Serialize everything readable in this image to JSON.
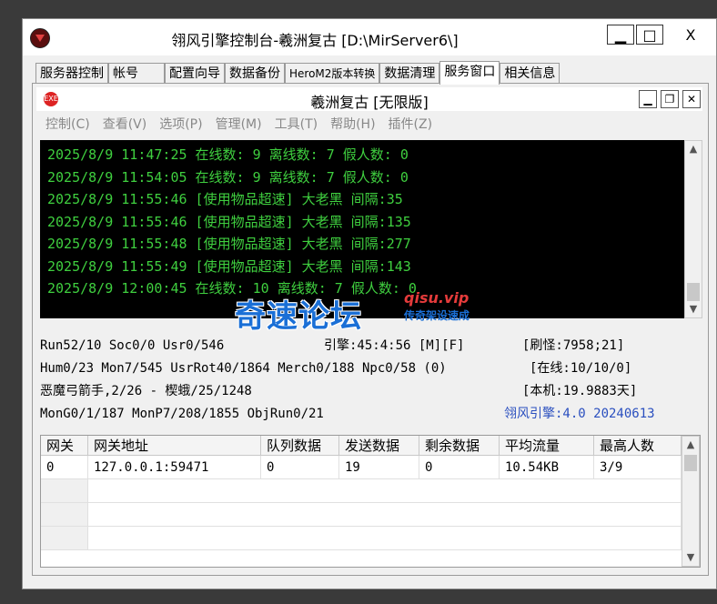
{
  "window": {
    "title": "翎风引擎控制台-羲洲复古 [D:\\MirServer6\\]",
    "minimize": "▁",
    "maximize": "□",
    "close": "X"
  },
  "tabs": [
    "服务器控制",
    "帐号",
    "配置向导",
    "数据备份",
    "HeroM2版本转换",
    "数据清理",
    "服务窗口",
    "相关信息"
  ],
  "active_tab": "服务窗口",
  "inner": {
    "title": "羲洲复古 [无限版]",
    "icon_text": "EXE",
    "minimize": "▁",
    "restore": "❐",
    "close": "✕"
  },
  "menu": [
    "控制(C)",
    "查看(V)",
    "选项(P)",
    "管理(M)",
    "工具(T)",
    "帮助(H)",
    "插件(Z)"
  ],
  "log_lines": [
    "2025/8/9 11:47:25 在线数: 9 离线数: 7 假人数: 0",
    "2025/8/9 11:54:05 在线数: 9 离线数: 7 假人数: 0",
    "2025/8/9 11:55:46 [使用物品超速] 大老黑 间隔:35",
    "2025/8/9 11:55:46 [使用物品超速] 大老黑 间隔:135",
    "2025/8/9 11:55:48 [使用物品超速] 大老黑 间隔:277",
    "2025/8/9 11:55:49 [使用物品超速] 大老黑 间隔:143",
    "2025/8/9 12:00:45 在线数: 10 离线数: 7 假人数: 0"
  ],
  "watermark": {
    "main": "奇速论坛",
    "url": "qisu.vip",
    "sub": "传奇架设速成"
  },
  "status": {
    "run": "Run52/10 Soc0/0 Usr0/546",
    "engine_time": "引擎:45:4:56 [M][F]",
    "refresh": "[刷怪:7958;21]",
    "hum": "Hum0/23 Mon7/545 UsrRot40/1864 Merch0/188 Npc0/58 (0)",
    "online": "[在线:10/10/0]",
    "map": "恶魔弓箭手,2/26 - 楔蛾/25/1248",
    "local": "[本机:19.9883天]",
    "mon": "MonG0/1/187 MonP7/208/1855 ObjRun0/21",
    "engine_version": "翎风引擎:4.0 20240613"
  },
  "grid": {
    "headers": [
      "网关",
      "网关地址",
      "队列数据",
      "发送数据",
      "剩余数据",
      "平均流量",
      "最高人数"
    ],
    "rows": [
      [
        "0",
        "127.0.0.1:59471",
        "0",
        "19",
        "0",
        "10.54KB",
        "3/9"
      ]
    ]
  },
  "scroll": {
    "up": "▲",
    "down": "▼"
  }
}
